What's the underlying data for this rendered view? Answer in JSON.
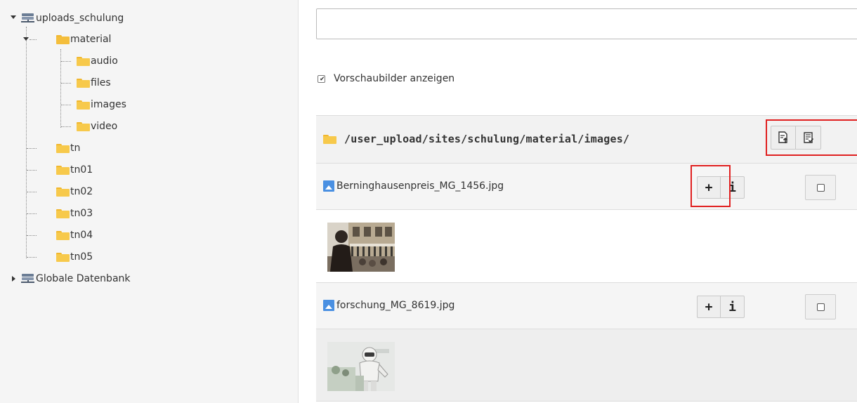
{
  "tree": {
    "roots": [
      {
        "label": "uploads_schulung",
        "icon": "server-icon",
        "expanded": true
      },
      {
        "label": "Globale Datenbank",
        "icon": "server-icon",
        "expanded": false
      }
    ],
    "material_label": "material",
    "material_children": [
      "audio",
      "files",
      "images",
      "video"
    ],
    "siblings": [
      "tn",
      "tn01",
      "tn02",
      "tn03",
      "tn04",
      "tn05"
    ]
  },
  "search": {
    "value": "",
    "placeholder": ""
  },
  "preview_checkbox": {
    "label": "Vorschaubilder anzeigen",
    "checked": true
  },
  "folder_path": "/user_upload/sites/schulung/material/images/",
  "header_buttons": [
    {
      "name": "upload-file-icon",
      "title": ""
    },
    {
      "name": "select-files-icon",
      "title": ""
    }
  ],
  "files": [
    {
      "name": "Berninghausenpreis_MG_1456.jpg",
      "add_label": "+",
      "info_label": "i"
    },
    {
      "name": "forschung_MG_8619.jpg",
      "add_label": "+",
      "info_label": "i"
    }
  ],
  "colors": {
    "highlight": "#e02020",
    "folder": "#f7c94b",
    "file_icon": "#4a90e2"
  }
}
